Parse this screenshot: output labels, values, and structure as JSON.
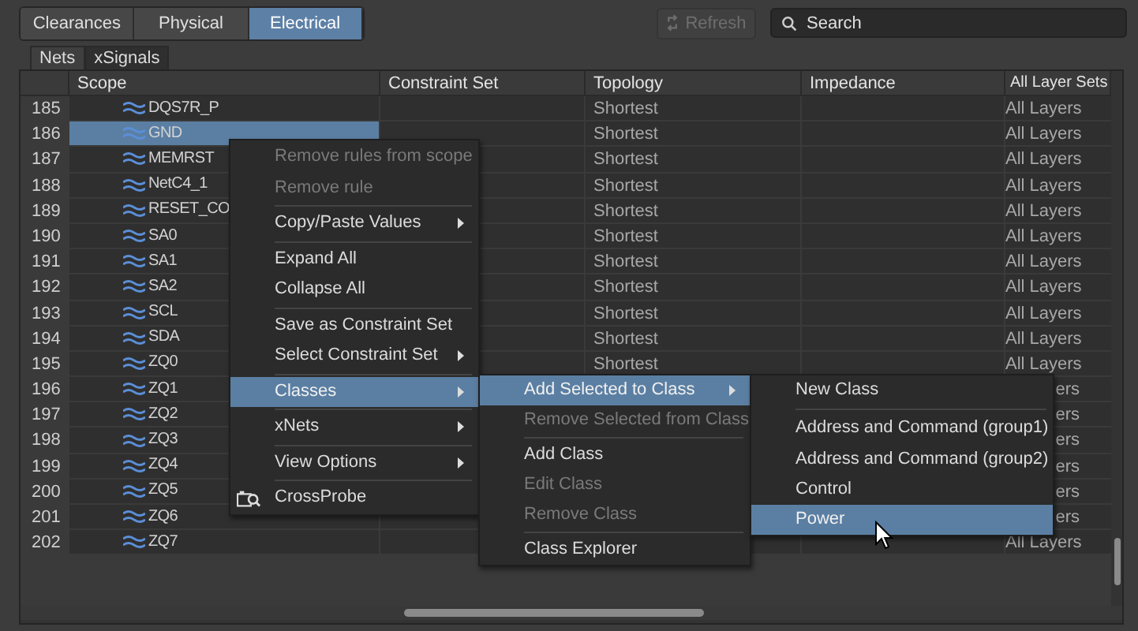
{
  "category_tabs": [
    {
      "label": "Clearances",
      "selected": false
    },
    {
      "label": "Physical",
      "selected": false
    },
    {
      "label": "Electrical",
      "selected": true
    }
  ],
  "refresh": {
    "label": "Refresh",
    "disabled": true
  },
  "search": {
    "placeholder": "Search"
  },
  "sub_tabs": [
    {
      "label": "Nets",
      "selected": false
    },
    {
      "label": "xSignals",
      "selected": true
    }
  ],
  "table": {
    "columns": [
      "Scope",
      "Constraint Set",
      "Topology",
      "Impedance",
      "All Layer Sets"
    ],
    "rows": [
      {
        "num": "185",
        "scope": "DQS7R_P",
        "selected": false,
        "topology": "Shortest",
        "layers": "All Layers"
      },
      {
        "num": "186",
        "scope": "GND",
        "selected": true,
        "topology": "Shortest",
        "layers": "All Layers"
      },
      {
        "num": "187",
        "scope": "MEMRST",
        "selected": false,
        "topology": "Shortest",
        "layers": "All Layers"
      },
      {
        "num": "188",
        "scope": "NetC4_1",
        "selected": false,
        "topology": "Shortest",
        "layers": "All Layers"
      },
      {
        "num": "189",
        "scope": "RESET_CO",
        "selected": false,
        "topology": "Shortest",
        "layers": "All Layers"
      },
      {
        "num": "190",
        "scope": "SA0",
        "selected": false,
        "topology": "Shortest",
        "layers": "All Layers"
      },
      {
        "num": "191",
        "scope": "SA1",
        "selected": false,
        "topology": "Shortest",
        "layers": "All Layers"
      },
      {
        "num": "192",
        "scope": "SA2",
        "selected": false,
        "topology": "Shortest",
        "layers": "All Layers"
      },
      {
        "num": "193",
        "scope": "SCL",
        "selected": false,
        "topology": "Shortest",
        "layers": "All Layers"
      },
      {
        "num": "194",
        "scope": "SDA",
        "selected": false,
        "topology": "Shortest",
        "layers": "All Layers"
      },
      {
        "num": "195",
        "scope": "ZQ0",
        "selected": false,
        "topology": "Shortest",
        "layers": "All Layers"
      },
      {
        "num": "196",
        "scope": "ZQ1",
        "selected": false,
        "layers": "ers"
      },
      {
        "num": "197",
        "scope": "ZQ2",
        "selected": false,
        "layers": "ers"
      },
      {
        "num": "198",
        "scope": "ZQ3",
        "selected": false,
        "layers": "ers"
      },
      {
        "num": "199",
        "scope": "ZQ4",
        "selected": false,
        "layers": "ers"
      },
      {
        "num": "200",
        "scope": "ZQ5",
        "selected": false,
        "layers": "ers"
      },
      {
        "num": "201",
        "scope": "ZQ6",
        "selected": false,
        "layers": "ers"
      },
      {
        "num": "202",
        "scope": "ZQ7",
        "selected": false,
        "layers": "All Layers"
      }
    ]
  },
  "context_menu": {
    "items": [
      {
        "kind": "item",
        "label": "Remove rules from scope",
        "disabled": true,
        "submenu": false,
        "selected": false
      },
      {
        "kind": "item",
        "label": "Remove rule",
        "disabled": true,
        "submenu": false,
        "selected": false
      },
      {
        "kind": "separator"
      },
      {
        "kind": "item",
        "label": "Copy/Paste Values",
        "disabled": false,
        "submenu": true,
        "selected": false
      },
      {
        "kind": "separator"
      },
      {
        "kind": "item",
        "label": "Expand All",
        "disabled": false,
        "submenu": false,
        "selected": false
      },
      {
        "kind": "item",
        "label": "Collapse All",
        "disabled": false,
        "submenu": false,
        "selected": false
      },
      {
        "kind": "separator"
      },
      {
        "kind": "item",
        "label": "Save as Constraint Set",
        "disabled": false,
        "submenu": false,
        "selected": false
      },
      {
        "kind": "item",
        "label": "Select Constraint Set",
        "disabled": false,
        "submenu": true,
        "selected": false
      },
      {
        "kind": "separator"
      },
      {
        "kind": "item",
        "label": "Classes",
        "disabled": false,
        "submenu": true,
        "selected": true
      },
      {
        "kind": "separator"
      },
      {
        "kind": "item",
        "label": "xNets",
        "disabled": false,
        "submenu": true,
        "selected": false
      },
      {
        "kind": "separator"
      },
      {
        "kind": "item",
        "label": "View Options",
        "disabled": false,
        "submenu": true,
        "selected": false
      },
      {
        "kind": "separator"
      },
      {
        "kind": "icon_item",
        "label": "CrossProbe",
        "disabled": false,
        "submenu": false,
        "selected": false
      }
    ]
  },
  "classes_menu": {
    "items": [
      {
        "kind": "item",
        "label": "Add Selected to Class",
        "disabled": false,
        "submenu": true,
        "selected": true
      },
      {
        "kind": "item",
        "label": "Remove Selected from Class",
        "disabled": true,
        "submenu": false,
        "selected": false
      },
      {
        "kind": "separator"
      },
      {
        "kind": "item",
        "label": "Add Class",
        "disabled": false,
        "submenu": false,
        "selected": false
      },
      {
        "kind": "item",
        "label": "Edit Class",
        "disabled": true,
        "submenu": false,
        "selected": false
      },
      {
        "kind": "item",
        "label": "Remove Class",
        "disabled": true,
        "submenu": false,
        "selected": false
      },
      {
        "kind": "separator"
      },
      {
        "kind": "item",
        "label": "Class Explorer",
        "disabled": false,
        "submenu": false,
        "selected": false
      }
    ]
  },
  "add_to_class_menu": {
    "items": [
      {
        "kind": "item",
        "label": "New Class",
        "disabled": false,
        "submenu": false,
        "selected": false
      },
      {
        "kind": "separator"
      },
      {
        "kind": "item",
        "label": "Address and Command (group1)",
        "disabled": false,
        "submenu": false,
        "selected": false
      },
      {
        "kind": "item",
        "label": "Address and Command (group2)",
        "disabled": false,
        "submenu": false,
        "selected": false
      },
      {
        "kind": "item",
        "label": "Control",
        "disabled": false,
        "submenu": false,
        "selected": false
      },
      {
        "kind": "item",
        "label": "Power",
        "disabled": false,
        "submenu": false,
        "selected": true
      }
    ]
  }
}
